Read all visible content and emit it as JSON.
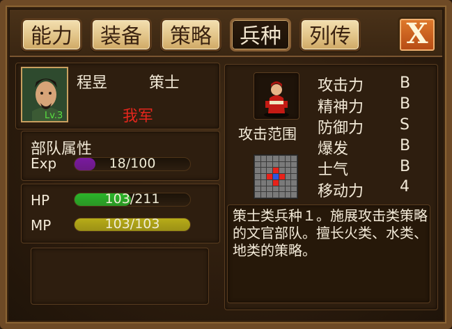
{
  "tabs": [
    {
      "label": "能力"
    },
    {
      "label": "装备"
    },
    {
      "label": "策略"
    },
    {
      "label": "兵种",
      "active": true
    },
    {
      "label": "列传"
    }
  ],
  "close_label": "X",
  "character": {
    "name": "程昱",
    "class": "策士",
    "faction": "我军",
    "level": "Lv.3"
  },
  "unit": {
    "title": "部队属性",
    "exp_label": "Exp",
    "exp_value": "18/100",
    "exp_fraction": 0.18,
    "hp_label": "HP",
    "hp_value": "103/211",
    "hp_fraction": 0.49,
    "mp_label": "MP",
    "mp_value": "103/103",
    "mp_fraction": 1.0
  },
  "troop": {
    "range_label": "攻击范围",
    "stats": [
      {
        "label": "攻击力",
        "grade": "B"
      },
      {
        "label": "精神力",
        "grade": "B"
      },
      {
        "label": "防御力",
        "grade": "S"
      },
      {
        "label": "爆发",
        "grade": "B"
      },
      {
        "label": "士气",
        "grade": "B"
      },
      {
        "label": "移动力",
        "grade": "4"
      }
    ],
    "description": "策士类兵种１。施展攻击类策略的文官部队。擅长火类、水类、地类的策略。"
  },
  "colors": {
    "exp_bar": "#7a1aa0",
    "hp_bar": "#2bb52a",
    "mp_bar": "#b8ad18",
    "faction": "#e4261c",
    "level": "#58e040"
  }
}
